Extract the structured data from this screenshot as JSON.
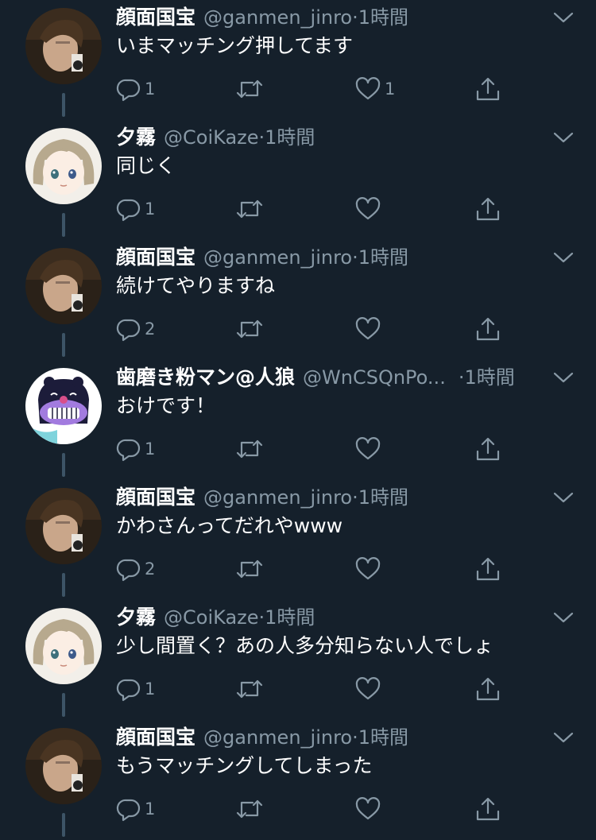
{
  "colors": {
    "background": "#15202b",
    "primary_text": "#ffffff",
    "secondary_text": "#8899a6",
    "thread_line": "#3d5466"
  },
  "icons": {
    "reply": "reply-icon",
    "retweet": "retweet-icon",
    "like": "heart-icon",
    "share": "share-icon",
    "menu": "chevron-down-icon"
  },
  "tweets": [
    {
      "name": "顔面国宝",
      "handle": "@ganmen_jinro",
      "separator": "·",
      "time": "1時間",
      "text": "いまマッチング押してます",
      "reply_count": "1",
      "like_count": "1",
      "avatar": "avatar-ganmen"
    },
    {
      "name": "夕霧",
      "handle": "@CoiKaze",
      "separator": "·",
      "time": "1時間",
      "text": "同じく",
      "reply_count": "1",
      "like_count": "",
      "avatar": "avatar-coikaze"
    },
    {
      "name": "顔面国宝",
      "handle": "@ganmen_jinro",
      "separator": "·",
      "time": "1時間",
      "text": "続けてやりますね",
      "reply_count": "2",
      "like_count": "",
      "avatar": "avatar-ganmen"
    },
    {
      "name": "歯磨き粉マン@人狼",
      "handle": "@WnCSQnPo...",
      "separator": "·",
      "time": "1時間",
      "text": "おけです！",
      "reply_count": "1",
      "like_count": "",
      "avatar": "avatar-hamigaki"
    },
    {
      "name": "顔面国宝",
      "handle": "@ganmen_jinro",
      "separator": "·",
      "time": "1時間",
      "text": "かわさんってだれやwww",
      "reply_count": "2",
      "like_count": "",
      "avatar": "avatar-ganmen"
    },
    {
      "name": "夕霧",
      "handle": "@CoiKaze",
      "separator": "·",
      "time": "1時間",
      "text": "少し間置く？あの人多分知らない人でしょ",
      "reply_count": "1",
      "like_count": "",
      "avatar": "avatar-coikaze"
    },
    {
      "name": "顔面国宝",
      "handle": "@ganmen_jinro",
      "separator": "·",
      "time": "1時間",
      "text": "もうマッチングしてしまった",
      "reply_count": "1",
      "like_count": "",
      "avatar": "avatar-ganmen"
    }
  ]
}
